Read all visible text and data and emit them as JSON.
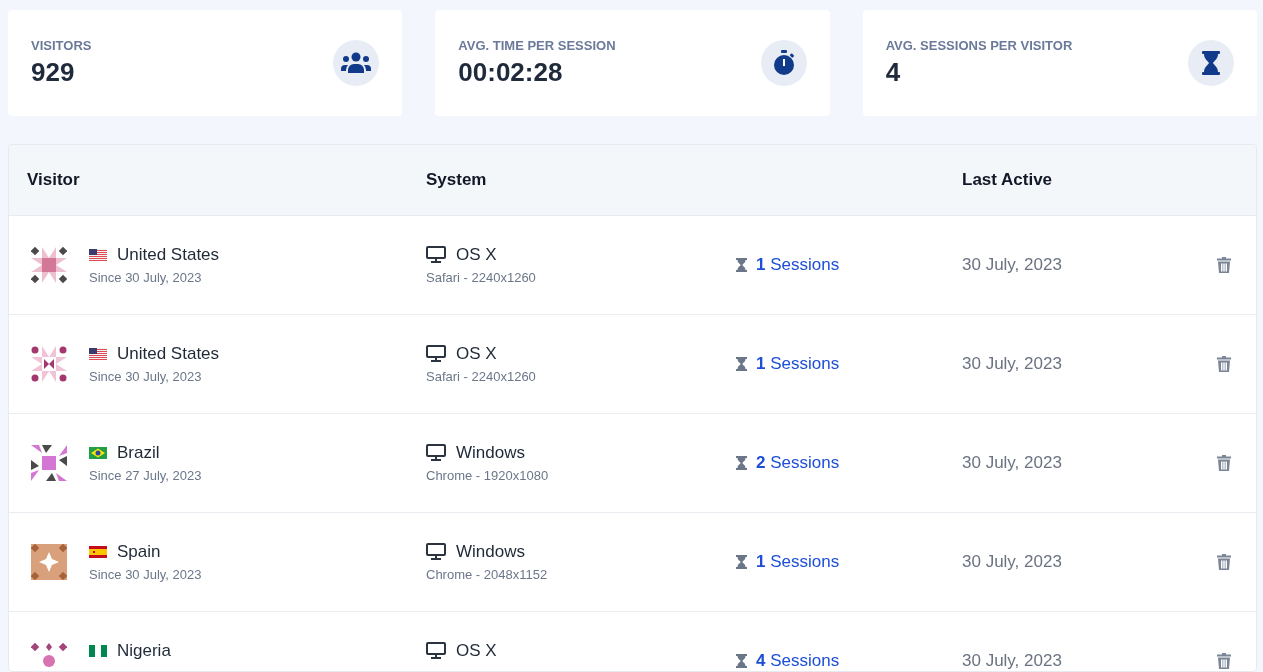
{
  "stats": [
    {
      "label": "VISITORS",
      "value": "929",
      "kind": "users"
    },
    {
      "label": "AVG. TIME PER SESSION",
      "value": "00:02:28",
      "kind": "stopwatch"
    },
    {
      "label": "AVG. SESSIONS PER VISITOR",
      "value": "4",
      "kind": "hourglass"
    }
  ],
  "table": {
    "columns": [
      "Visitor",
      "System",
      "Last Active"
    ],
    "rows": [
      {
        "avatar": {
          "kind": "a",
          "color": "#d4789a"
        },
        "flag": {
          "kind": "us"
        },
        "country": "United States",
        "since": "Since 30 July, 2023",
        "os": "OS X",
        "browser": "Safari - 2240x1260",
        "session_count": "1",
        "sessions_label": "Sessions",
        "last_active": "30 July, 2023"
      },
      {
        "avatar": {
          "kind": "b",
          "color": "#a3376f"
        },
        "flag": {
          "kind": "us"
        },
        "country": "United States",
        "since": "Since 30 July, 2023",
        "os": "OS X",
        "browser": "Safari - 2240x1260",
        "session_count": "1",
        "sessions_label": "Sessions",
        "last_active": "30 July, 2023"
      },
      {
        "avatar": {
          "kind": "c",
          "color": "#d477d4"
        },
        "flag": {
          "kind": "br"
        },
        "country": "Brazil",
        "since": "Since 27 July, 2023",
        "os": "Windows",
        "browser": "Chrome - 1920x1080",
        "session_count": "2",
        "sessions_label": "Sessions",
        "last_active": "30 July, 2023"
      },
      {
        "avatar": {
          "kind": "d",
          "color": "#d9a07c"
        },
        "flag": {
          "kind": "es"
        },
        "country": "Spain",
        "since": "Since 30 July, 2023",
        "os": "Windows",
        "browser": "Chrome - 2048x1152",
        "session_count": "1",
        "sessions_label": "Sessions",
        "last_active": "30 July, 2023"
      },
      {
        "avatar": {
          "kind": "e",
          "color": "#a5447a"
        },
        "flag": {
          "kind": "ng"
        },
        "country": "Nigeria",
        "os": "OS X",
        "session_count": "4",
        "sessions_label": "Sessions",
        "last_active": "30 July, 2023"
      }
    ]
  }
}
